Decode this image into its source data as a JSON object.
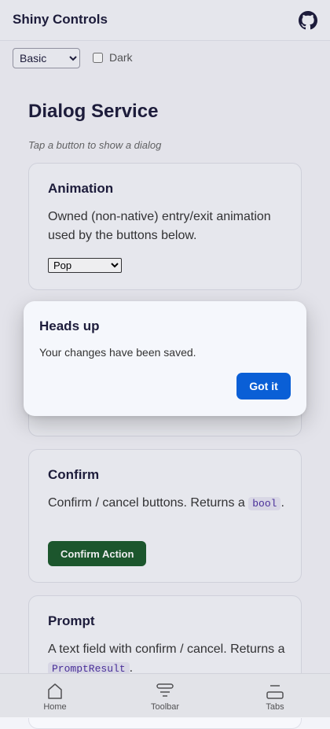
{
  "header": {
    "title": "Shiny Controls",
    "github_icon": "github-icon"
  },
  "controls": {
    "theme_select": {
      "value": "Basic",
      "options": [
        "Basic"
      ]
    },
    "dark_label": "Dark",
    "dark_checked": false
  },
  "page": {
    "title": "Dialog Service",
    "subtitle": "Tap a button to show a dialog"
  },
  "cards": {
    "animation": {
      "title": "Animation",
      "desc": "Owned (non-native) entry/exit animation used by the buttons below.",
      "select": {
        "value": "Pop",
        "options": [
          "Pop"
        ]
      }
    },
    "confirm": {
      "title": "Confirm",
      "desc_prefix": "Confirm / cancel buttons. Returns a ",
      "desc_code": "bool",
      "desc_suffix": ".",
      "button": "Confirm Action"
    },
    "prompt": {
      "title": "Prompt",
      "desc_prefix": "A text field with confirm / cancel. Returns a ",
      "desc_code": "PromptResult",
      "desc_suffix": "."
    }
  },
  "tabbar": [
    {
      "label": "Home",
      "icon": "home-icon"
    },
    {
      "label": "Toolbar",
      "icon": "toolbar-icon"
    },
    {
      "label": "Tabs",
      "icon": "tabs-icon"
    }
  ],
  "dialog": {
    "title": "Heads up",
    "message": "Your changes have been saved.",
    "button": "Got it"
  },
  "colors": {
    "accent": "#0a5fd6",
    "confirm": "#1c5b2c",
    "hidden_button": "#5b35c9"
  }
}
